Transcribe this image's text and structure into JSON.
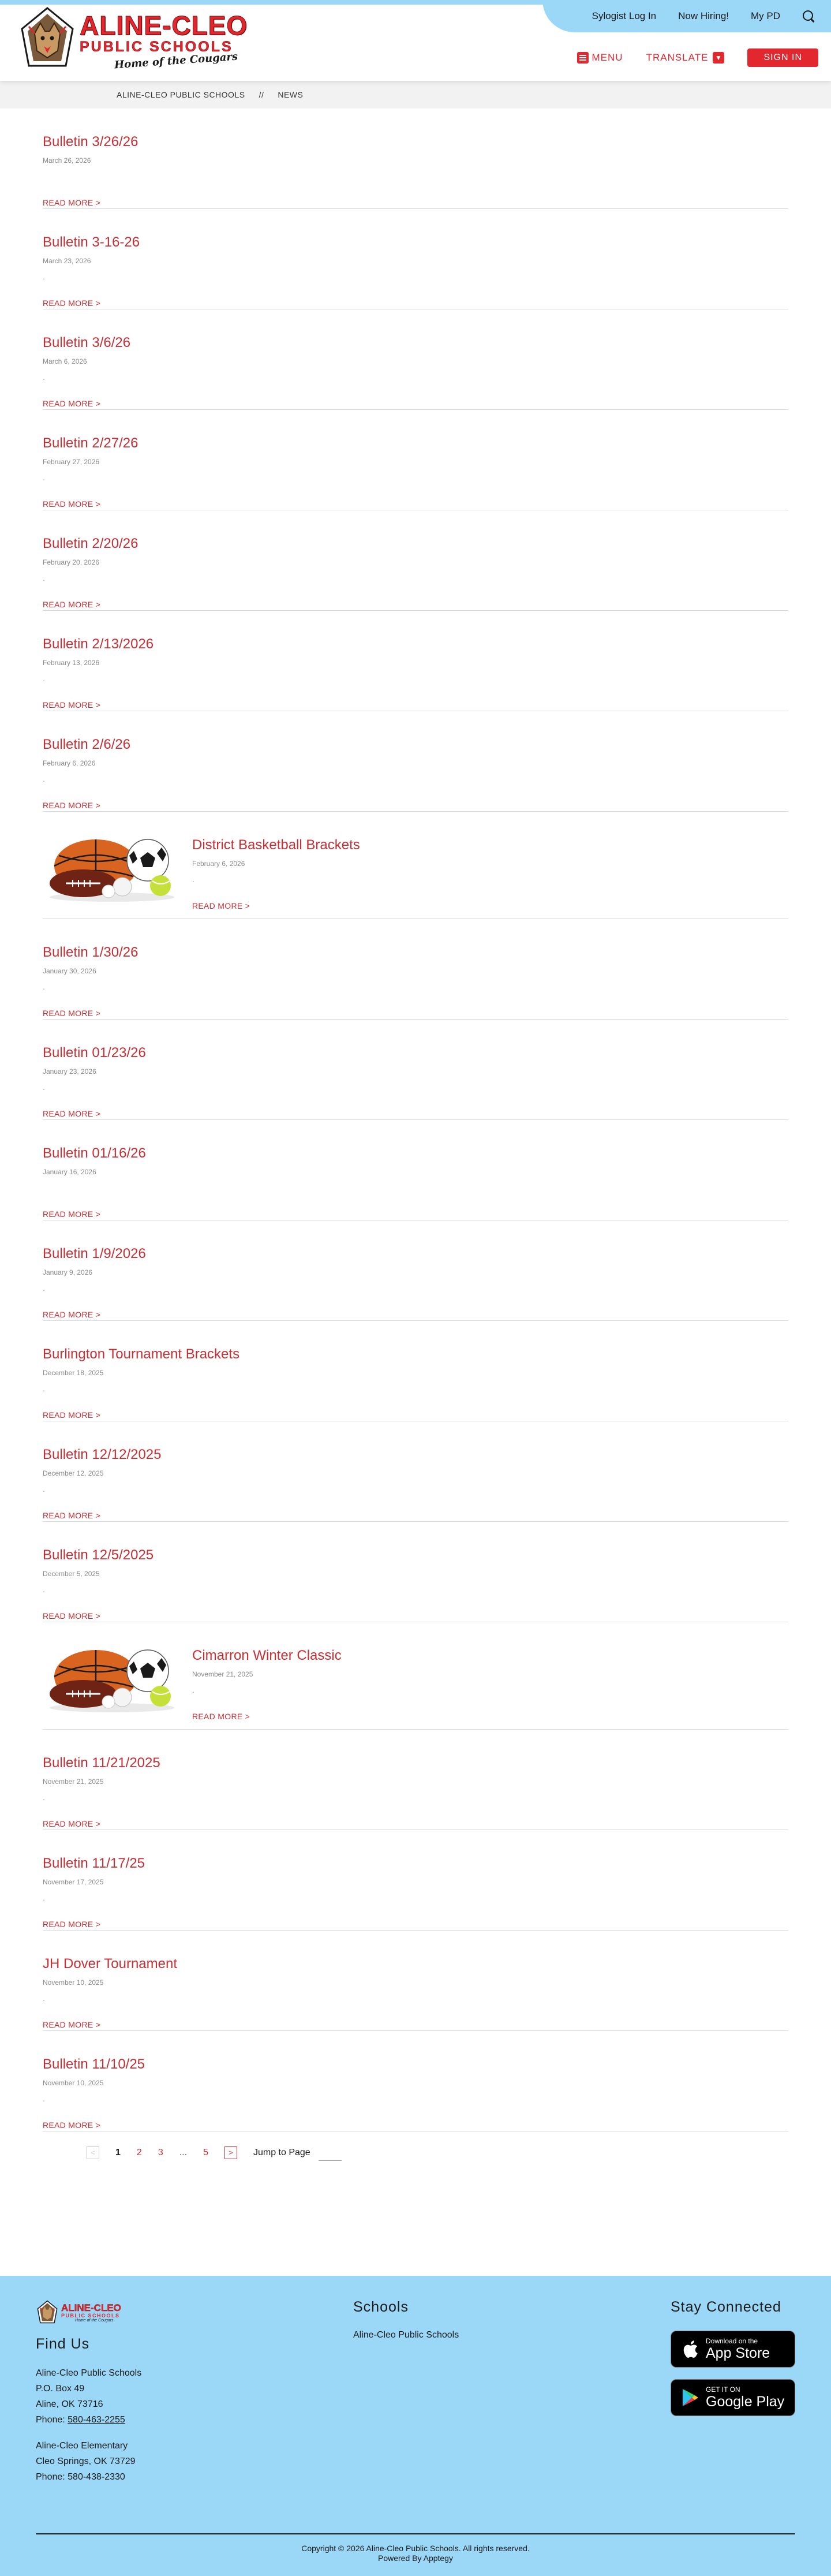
{
  "header": {
    "top_links": [
      "Sylogist Log In",
      "Now Hiring!",
      "My PD"
    ],
    "logo": {
      "name": "ALINE-CLEO",
      "sub": "PUBLIC SCHOOLS",
      "tagline": "Home of the Cougars"
    },
    "menu_label": "MENU",
    "translate_label": "TRANSLATE",
    "signin_label": "SIGN IN",
    "colors": {
      "accent": "#e2272f",
      "band": "#9bd7f7"
    }
  },
  "breadcrumb": {
    "home": "ALINE-CLEO PUBLIC SCHOOLS",
    "separator": "//",
    "current": "NEWS"
  },
  "read_more": "READ MORE >",
  "news": [
    {
      "title": "Bulletin 3/26/26",
      "date": "March 26, 2026",
      "excerpt": "",
      "image": false
    },
    {
      "title": "Bulletin 3-16-26",
      "date": "March 23, 2026",
      "excerpt": ".",
      "image": false
    },
    {
      "title": "Bulletin 3/6/26",
      "date": "March 6, 2026",
      "excerpt": ".",
      "image": false
    },
    {
      "title": "Bulletin 2/27/26",
      "date": "February 27, 2026",
      "excerpt": ".",
      "image": false
    },
    {
      "title": "Bulletin 2/20/26",
      "date": "February 20, 2026",
      "excerpt": ".",
      "image": false
    },
    {
      "title": "Bulletin 2/13/2026",
      "date": "February 13, 2026",
      "excerpt": ".",
      "image": false
    },
    {
      "title": "Bulletin 2/6/26",
      "date": "February 6, 2026",
      "excerpt": ".",
      "image": false
    },
    {
      "title": "District Basketball Brackets",
      "date": "February 6, 2026",
      "excerpt": ".",
      "image": true
    },
    {
      "title": "Bulletin 1/30/26",
      "date": "January 30, 2026",
      "excerpt": ".",
      "image": false
    },
    {
      "title": "Bulletin 01/23/26",
      "date": "January 23, 2026",
      "excerpt": ".",
      "image": false
    },
    {
      "title": "Bulletin 01/16/26",
      "date": "January 16, 2026",
      "excerpt": "",
      "image": false
    },
    {
      "title": "Bulletin 1/9/2026",
      "date": "January 9, 2026",
      "excerpt": ".",
      "image": false
    },
    {
      "title": "Burlington Tournament Brackets",
      "date": "December 18, 2025",
      "excerpt": ".",
      "image": false
    },
    {
      "title": "Bulletin 12/12/2025",
      "date": "December 12, 2025",
      "excerpt": ".",
      "image": false
    },
    {
      "title": "Bulletin 12/5/2025",
      "date": "December 5, 2025",
      "excerpt": ".",
      "image": false
    },
    {
      "title": "Cimarron Winter Classic",
      "date": "November 21, 2025",
      "excerpt": ".",
      "image": true
    },
    {
      "title": "Bulletin 11/21/2025",
      "date": "November 21, 2025",
      "excerpt": ".",
      "image": false
    },
    {
      "title": "Bulletin 11/17/25",
      "date": "November 17, 2025",
      "excerpt": ".",
      "image": false
    },
    {
      "title": "JH Dover Tournament",
      "date": "November 10, 2025",
      "excerpt": ".",
      "image": false
    },
    {
      "title": "Bulletin 11/10/25",
      "date": "November 10, 2025",
      "excerpt": ".",
      "image": false
    }
  ],
  "pagination": {
    "prev": "<",
    "next": ">",
    "pages": [
      "1",
      "2",
      "3"
    ],
    "ellipsis": "...",
    "last": "5",
    "current": "1",
    "jump_label": "Jump to Page"
  },
  "footer": {
    "logo": {
      "name": "ALINE-CLEO",
      "sub": "PUBLIC SCHOOLS",
      "tagline": "Home of the Cougars"
    },
    "find_us": {
      "heading": "Find Us",
      "school1": [
        "Aline-Cleo Public Schools",
        "P.O. Box 49",
        "Aline, OK 73716"
      ],
      "school1_phone_label": "Phone: ",
      "school1_phone": "580-463-2255",
      "school2": [
        "Aline-Cleo Elementary",
        "Cleo Springs, OK 73729",
        "Phone: 580-438-2330"
      ]
    },
    "schools": {
      "heading": "Schools",
      "items": [
        "Aline-Cleo Public Schools"
      ]
    },
    "stay_connected": {
      "heading": "Stay Connected",
      "app_store_small": "Download on the",
      "app_store_big": "App Store",
      "google_small": "GET IT ON",
      "google_big": "Google Play"
    },
    "copyright": "Copyright © 2026 Aline-Cleo Public Schools. All rights reserved.",
    "powered_by": "Powered By Apptegy"
  }
}
